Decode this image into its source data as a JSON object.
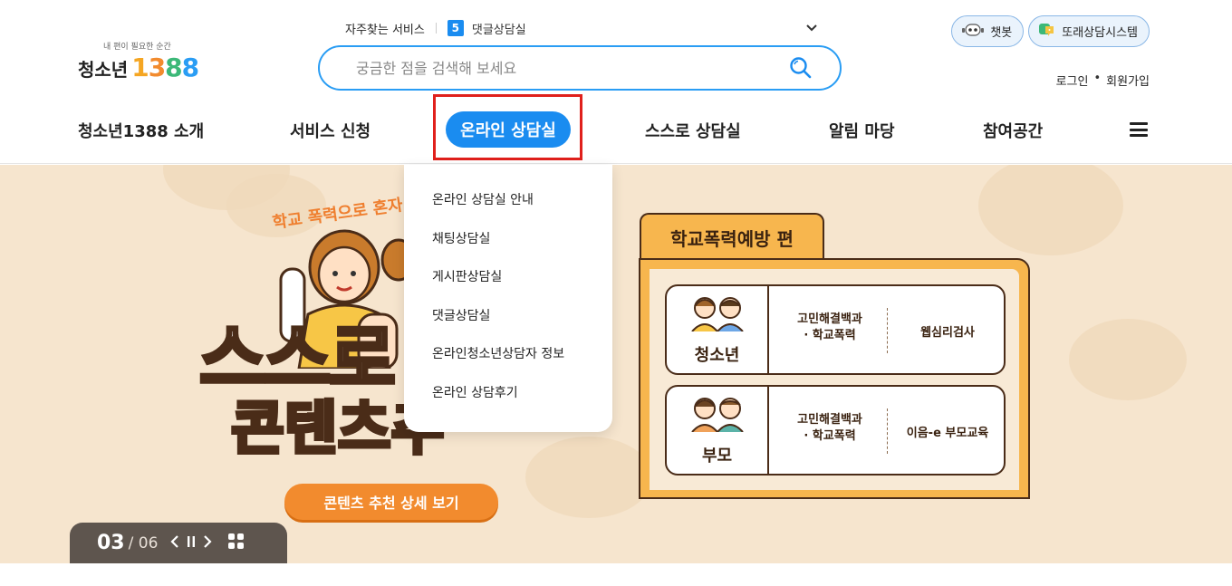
{
  "logo": {
    "tagline": "내 편이 필요한 순간",
    "name": "청소년",
    "digits": [
      "1",
      "3",
      "8",
      "8"
    ]
  },
  "faq": {
    "label": "자주찾는 서비스",
    "rank": "5",
    "item": "댓글상담실"
  },
  "search": {
    "placeholder": "궁금한 점을 검색해 보세요"
  },
  "top_buttons": {
    "chatbot": "챗봇",
    "peer": "또래상담시스템"
  },
  "auth": {
    "login": "로그인",
    "separator": "•",
    "signup": "회원가입"
  },
  "nav": {
    "items": [
      "청소년1388 소개",
      "서비스 신청",
      "온라인 상담실",
      "스스로 상담실",
      "알림 마당",
      "참여공간"
    ],
    "active_index": 2
  },
  "dropdown": {
    "items": [
      "온라인 상담실 안내",
      "채팅상담실",
      "게시판상담실",
      "댓글상담실",
      "온라인청소년상담자 정보",
      "온라인 상담후기"
    ]
  },
  "hero": {
    "tagline": "학교 폭력으로 혼자",
    "headline1": "스스로",
    "headline2": "콘텐츠추",
    "cta": "콘텐츠 추천 상세 보기",
    "panel_title": "학교폭력예방 편",
    "cards": [
      {
        "audience": "청소년",
        "mid_line1": "고민해결백과",
        "mid_line2": "· 학교폭력",
        "right": "웹심리검사"
      },
      {
        "audience": "부모",
        "mid_line1": "고민해결백과",
        "mid_line2": "· 학교폭력",
        "right": "이음-e 부모교육"
      }
    ]
  },
  "pager": {
    "current": "03",
    "separator": "/",
    "total": "06"
  },
  "colors": {
    "primary": "#1a8cf0",
    "highlight": "#e0201c",
    "hero_bg": "#f6e5ce",
    "accent_orange": "#f28b2e"
  }
}
